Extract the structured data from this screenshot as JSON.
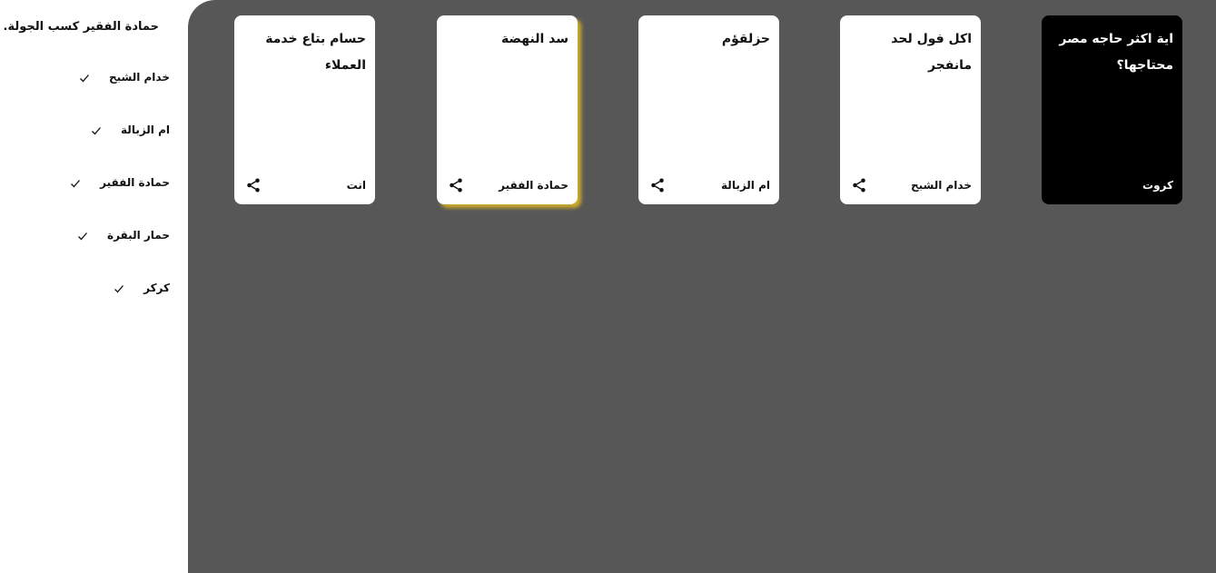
{
  "sidebar": {
    "round_title": "حمادة الفقير كسب الجولة.",
    "players": [
      {
        "name": "خدام الشبح",
        "checked": true
      },
      {
        "name": "ام الزبالة",
        "checked": true
      },
      {
        "name": "حمادة الفقير",
        "checked": true
      },
      {
        "name": "حمار البقرة",
        "checked": true
      },
      {
        "name": "كركر",
        "checked": true
      }
    ]
  },
  "board": {
    "prompt_card": {
      "text": "اية اكثر حاجه مصر محتاجها؟",
      "author": "كروت",
      "color": "#000000"
    },
    "answer_cards": [
      {
        "text": "اكل فول لحد مانفجر",
        "author": "خدام الشبح",
        "selected": false
      },
      {
        "text": "حزلقؤم",
        "author": "ام الزبالة",
        "selected": false
      },
      {
        "text": "سد النهضة",
        "author": "حمادة الفقير",
        "selected": true
      },
      {
        "text": "حسام بتاع خدمة العملاء",
        "author": "انت",
        "selected": false
      }
    ]
  },
  "colors": {
    "board_background": "#575757",
    "selected_highlight": "#d6b028",
    "card_white": "#ffffff",
    "card_black": "#000000"
  },
  "icons": {
    "check": "check-icon",
    "share": "share-icon"
  }
}
